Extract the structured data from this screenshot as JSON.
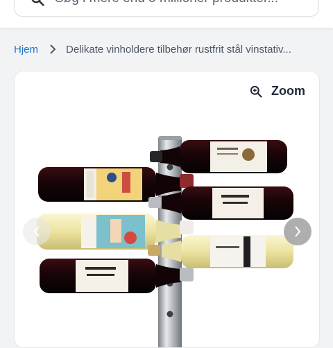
{
  "search": {
    "placeholder": "Søg i mere end 5 millioner produkter..."
  },
  "breadcrumb": {
    "home": "Hjem",
    "current": "Delikate vinholdere tilbehør rustfrit stål vinstativ..."
  },
  "gallery": {
    "zoom_label": "Zoom"
  },
  "colors": {
    "link": "#1a73c8",
    "text": "#1f2937",
    "muted": "#4b5563"
  },
  "icons": [
    "search-icon",
    "chevron-right-icon",
    "zoom-in-icon",
    "chevron-left-icon"
  ]
}
